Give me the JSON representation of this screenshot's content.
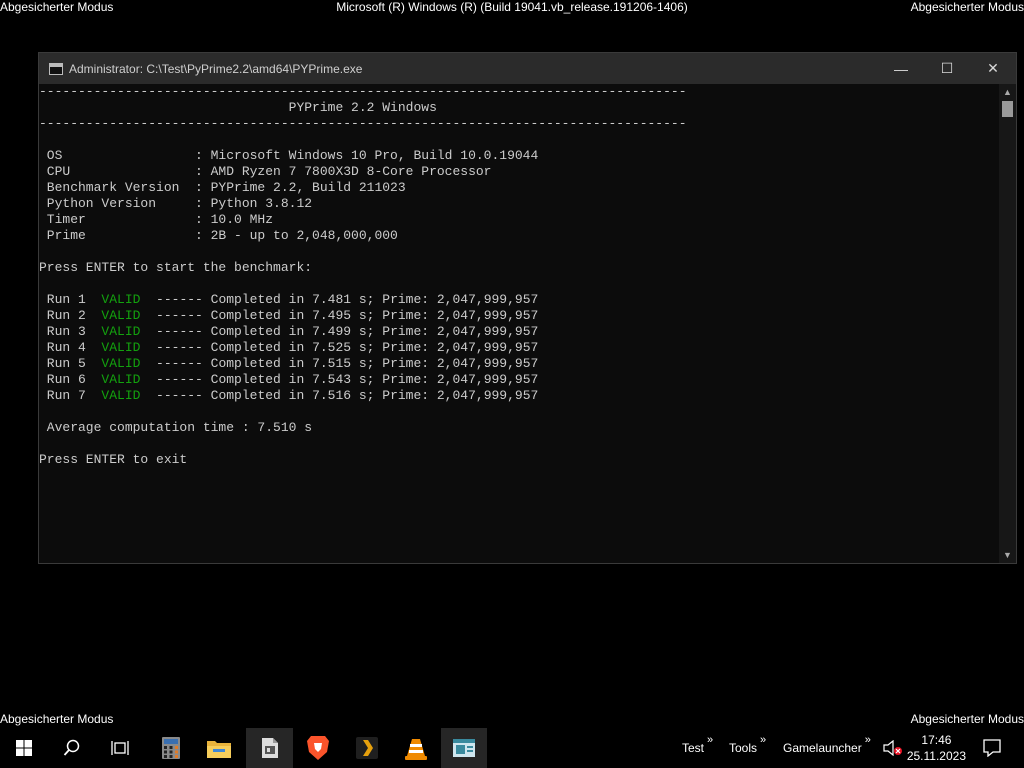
{
  "safe_mode": {
    "top_left": "Abgesicherter Modus",
    "top_right": "Abgesicherter Modus",
    "bottom_left": "Abgesicherter Modus",
    "bottom_right": "Abgesicherter Modus",
    "build": "Microsoft (R) Windows (R) (Build 19041.vb_release.191206-1406)"
  },
  "window": {
    "title": "Administrator: C:\\Test\\PyPrime2.2\\amd64\\PYPrime.exe",
    "minimize_glyph": "—",
    "maximize_glyph": "☐",
    "close_glyph": "✕"
  },
  "console": {
    "rule": "-----------------------------------------------------------------------------------",
    "heading": "                                PYPrime 2.2 Windows",
    "info": [
      " OS                 : Microsoft Windows 10 Pro, Build 10.0.19044",
      " CPU                : AMD Ryzen 7 7800X3D 8-Core Processor",
      " Benchmark Version  : PYPrime 2.2, Build 211023",
      " Python Version     : Python 3.8.12",
      " Timer              : 10.0 MHz",
      " Prime              : 2B - up to 2,048,000,000"
    ],
    "prompt_start": "Press ENTER to start the benchmark:",
    "runs": [
      {
        "label": " Run 1  ",
        "status": "VALID",
        "result": "  ------ Completed in 7.481 s; Prime: 2,047,999,957"
      },
      {
        "label": " Run 2  ",
        "status": "VALID",
        "result": "  ------ Completed in 7.495 s; Prime: 2,047,999,957"
      },
      {
        "label": " Run 3  ",
        "status": "VALID",
        "result": "  ------ Completed in 7.499 s; Prime: 2,047,999,957"
      },
      {
        "label": " Run 4  ",
        "status": "VALID",
        "result": "  ------ Completed in 7.525 s; Prime: 2,047,999,957"
      },
      {
        "label": " Run 5  ",
        "status": "VALID",
        "result": "  ------ Completed in 7.515 s; Prime: 2,047,999,957"
      },
      {
        "label": " Run 6  ",
        "status": "VALID",
        "result": "  ------ Completed in 7.543 s; Prime: 2,047,999,957"
      },
      {
        "label": " Run 7  ",
        "status": "VALID",
        "result": "  ------ Completed in 7.516 s; Prime: 2,047,999,957"
      }
    ],
    "average": " Average computation time : 7.510 s",
    "prompt_exit": "Press ENTER to exit",
    "valid_color": "#13a10e"
  },
  "taskbar": {
    "apps": [
      "windows-start-icon",
      "search-icon",
      "task-view-icon",
      "calculator-icon",
      "file-explorer-icon",
      "pyprime-icon",
      "brave-browser-icon",
      "plex-icon",
      "vlc-icon",
      "console-window-icon"
    ],
    "toolbars": [
      "Test",
      "Tools",
      "Gamelauncher"
    ],
    "chevron": "»",
    "time": "17:46",
    "date": "25.11.2023"
  }
}
